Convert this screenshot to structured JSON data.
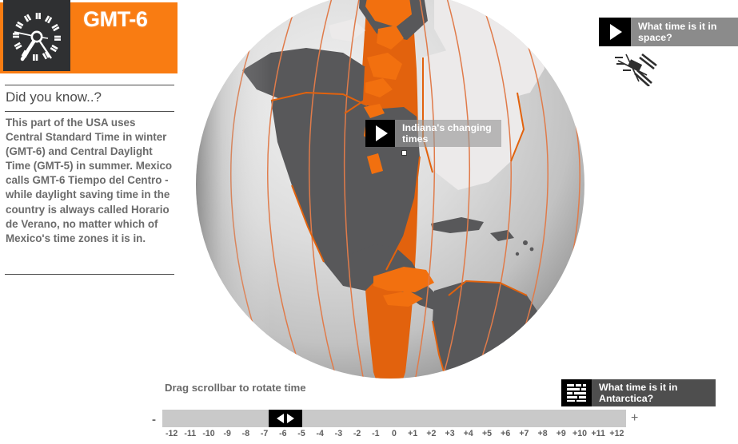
{
  "header": {
    "gmt_label": "GMT-6",
    "clock_icon": "clock-icon",
    "band_color": "#f97c12",
    "clock_box_color": "#2f3032"
  },
  "fact": {
    "heading": "Did you know..?",
    "body": "This part of the USA uses Central Standard Time in winter (GMT-6) and Central Daylight Time (GMT-5) in summer. Mexico calls GMT-6 Tiempo del Centro - while daylight saving time in the country is always called Horario de Verano, no matter which of Mexico's time zones it is in."
  },
  "globe": {
    "highlight_color": "#e2620d",
    "land_color": "#58585a",
    "land_inactive_color": "#eceaea",
    "ocean_color": "#c7c7c7",
    "meridian_color": "#e07b4a"
  },
  "cards": {
    "space": {
      "label": "What time is it in space?",
      "icon": "play-icon",
      "decor_icon": "space-station-icon",
      "bg": "#8b8b8b"
    },
    "indiana": {
      "label": "Indiana's changing times",
      "icon": "play-icon",
      "marker": "location-marker"
    },
    "antarctica": {
      "label": "What time is it in Antarctica?",
      "icon": "article-text-icon",
      "bg": "#4e4e4e"
    }
  },
  "scrollbar": {
    "hint": "Drag scrollbar to rotate time",
    "minus_label": "-",
    "plus_label": "+",
    "thumb_icon": "left-right-arrows-icon",
    "current_value": "-6",
    "ticks": [
      "-12",
      "-11",
      "-10",
      "-9",
      "-8",
      "-7",
      "-6",
      "-5",
      "-4",
      "-3",
      "-2",
      "-1",
      "0",
      "+1",
      "+2",
      "+3",
      "+4",
      "+5",
      "+6",
      "+7",
      "+8",
      "+9",
      "+10",
      "+11",
      "+12"
    ]
  }
}
